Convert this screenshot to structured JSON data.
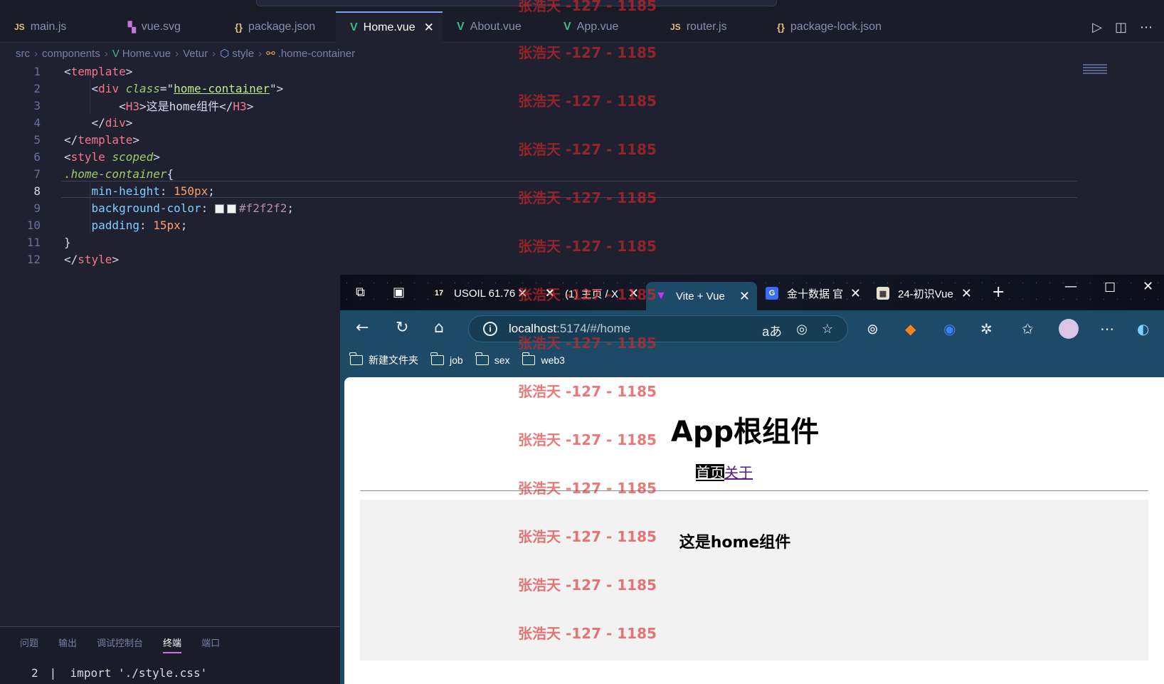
{
  "editor": {
    "tabs": [
      {
        "label": "main.js",
        "icon": "js"
      },
      {
        "label": "vue.svg",
        "icon": "svg"
      },
      {
        "label": "package.json",
        "icon": "json"
      },
      {
        "label": "Home.vue",
        "icon": "vue",
        "active": true
      },
      {
        "label": "About.vue",
        "icon": "vue"
      },
      {
        "label": "App.vue",
        "icon": "vue"
      },
      {
        "label": "router.js",
        "icon": "js"
      },
      {
        "label": "package-lock.json",
        "icon": "json"
      }
    ],
    "breadcrumb": {
      "src": "src",
      "components": "components",
      "file": "Home.vue",
      "lang": "Vetur",
      "style": "style",
      "symbol": ".home-container"
    },
    "line_numbers": [
      "1",
      "2",
      "3",
      "4",
      "5",
      "6",
      "7",
      "8",
      "9",
      "10",
      "11",
      "12"
    ],
    "code": {
      "l2_class": "home-container",
      "l3_text": "这是home组件",
      "l7_selector": ".home-container",
      "l8_prop": "min-height",
      "l8_val": "150px",
      "l9_prop": "background-color",
      "l9_val": "#f2f2f2",
      "l10_prop": "padding",
      "l10_val": "15px"
    }
  },
  "panel": {
    "tabs": [
      "问题",
      "输出",
      "调试控制台",
      "终端",
      "端口"
    ],
    "active_tab": "终端",
    "terminal_line_no": "2",
    "terminal_text": "import './style.css'"
  },
  "browser": {
    "tabs": [
      {
        "label": "USOIL 61.76"
      },
      {
        "label": "(1) 主页 / X"
      },
      {
        "label": "Vite + Vue",
        "active": true
      },
      {
        "label": "金十数据 官"
      },
      {
        "label": "24-初识Vue"
      }
    ],
    "url_host": "localhost",
    "url_rest": ":5174/#/home",
    "bookmarks": [
      "新建文件夹",
      "job",
      "sex",
      "web3"
    ],
    "page": {
      "title": "App根组件",
      "nav_home": "首页",
      "nav_about": "关于",
      "home_text": "这是home组件"
    }
  },
  "watermark": "张浩天 -127 - 1185",
  "colors": {
    "editor_bg": "#1f2130",
    "browser_chrome": "#1d4a66",
    "home_box_bg": "#f2f2f2",
    "watermark": "#dc2626"
  }
}
